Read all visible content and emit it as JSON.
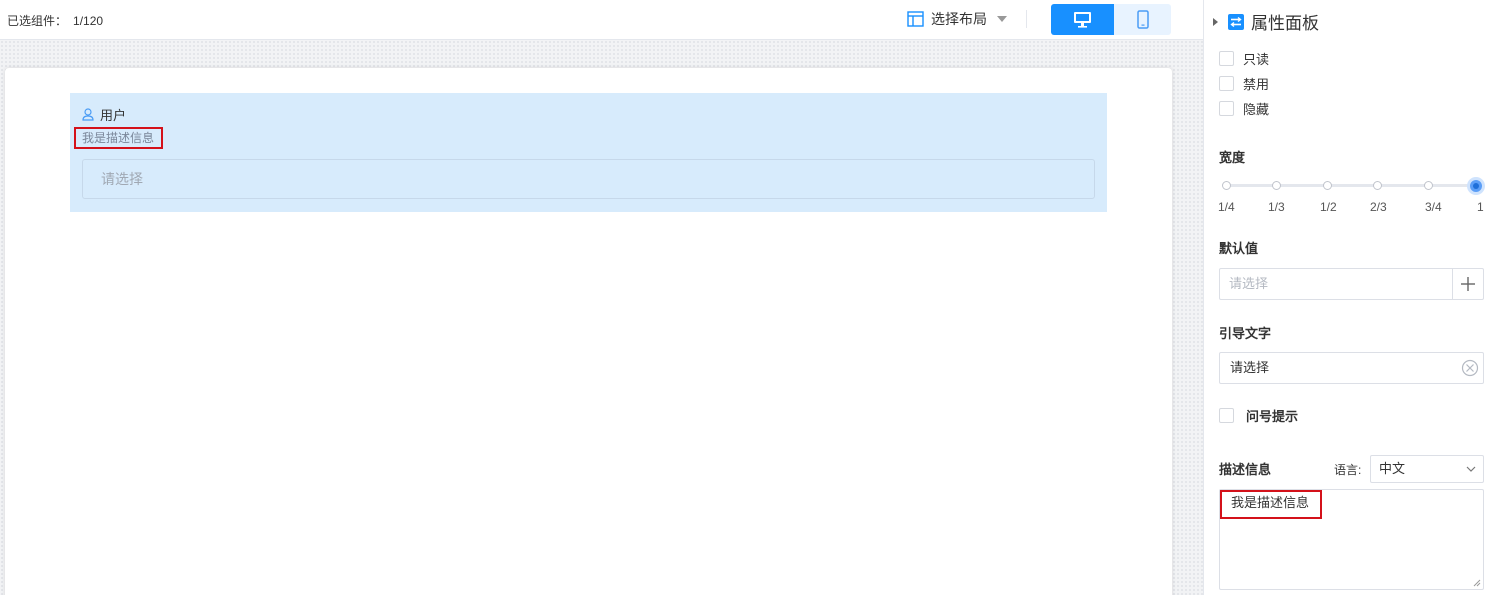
{
  "toolbar": {
    "selected_label": "已选组件：",
    "selected_count": "1/120",
    "layout_select_label": "选择布局"
  },
  "canvas": {
    "field": {
      "label": "用户",
      "description": "我是描述信息",
      "placeholder": "请选择"
    }
  },
  "panel": {
    "title": "属性面板",
    "checkboxes": [
      {
        "label": "只读",
        "checked": false
      },
      {
        "label": "禁用",
        "checked": false
      },
      {
        "label": "隐藏",
        "checked": false
      }
    ],
    "width_section": {
      "title": "宽度",
      "ticks": [
        "1/4",
        "1/3",
        "1/2",
        "2/3",
        "3/4",
        "1"
      ],
      "selected": "1"
    },
    "default_value": {
      "title": "默认值",
      "placeholder": "请选择"
    },
    "guide_text": {
      "title": "引导文字",
      "value": "请选择"
    },
    "question_tip": {
      "label": "问号提示",
      "checked": false
    },
    "description": {
      "title": "描述信息",
      "language_label": "语言:",
      "language_value": "中文",
      "value": "我是描述信息"
    }
  },
  "colors": {
    "primary": "#1890ff",
    "field_bg": "#d7ebfc",
    "highlight_border": "#d4111a"
  }
}
